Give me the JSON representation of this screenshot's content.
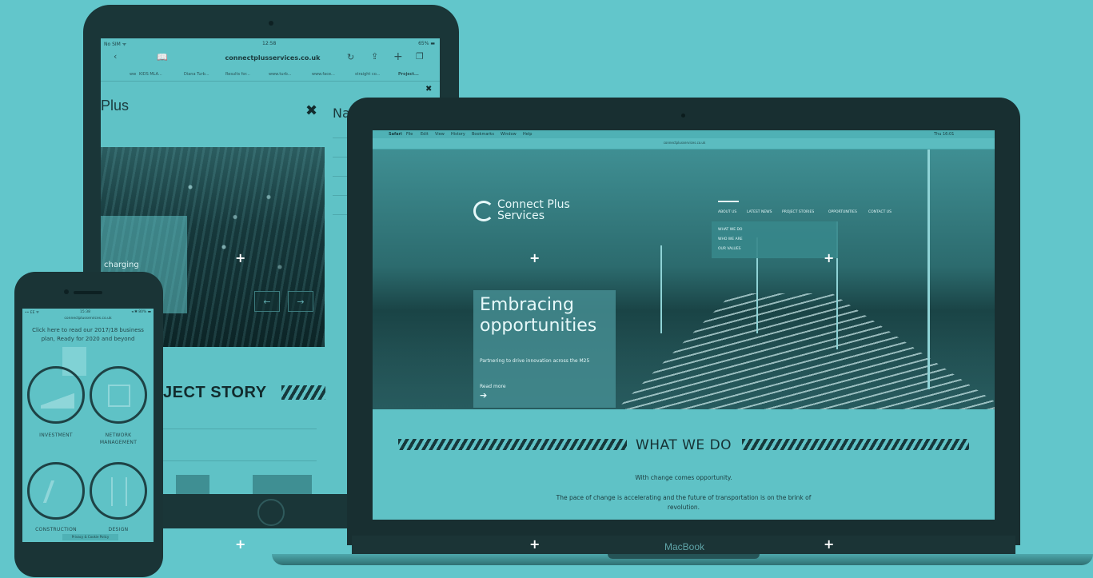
{
  "tablet": {
    "status_left": "No SIM ᯤ",
    "status_time": "12:58",
    "status_right": "65% ▬",
    "url": "connectplusservices.co.uk",
    "favorites": [
      "ww",
      "KIDS MLA...",
      "Diana Turb...",
      "Results for...",
      "www.turb...",
      "www.face...",
      "straight co...",
      "Project..."
    ],
    "page_title": "Plus",
    "nav_title": "Na",
    "image_caption": "charging",
    "section_title": "OJECT STORY"
  },
  "laptop": {
    "menubar": [
      "Safari",
      "File",
      "Edit",
      "View",
      "History",
      "Bookmarks",
      "Window",
      "Help"
    ],
    "menubar_right": "Thu 16:01",
    "url": "connectplusservices.co.uk",
    "logo_line1": "Connect Plus",
    "logo_line2": "Services",
    "nav": [
      "ABOUT US",
      "LATEST NEWS",
      "PROJECT STORIES",
      "OPPORTUNITIES",
      "CONTACT US"
    ],
    "dropdown": [
      "WHAT WE DO",
      "WHO WE ARE",
      "OUR VALUES"
    ],
    "hero_title_1": "Embracing",
    "hero_title_2": "opportunities",
    "hero_subtitle": "Partnering to drive innovation across the M25",
    "hero_link": "Read more",
    "hero_arrow": "➔",
    "section_title": "WHAT WE DO",
    "body_1": "With change comes opportunity.",
    "body_2": "The pace of change is accelerating and the future of transportation is on the brink of revolution.",
    "brand": "MacBook"
  },
  "phone": {
    "status_left": "•• EE ᯤ",
    "status_time": "15:38",
    "status_right": "◂ ✱ 80% ▬",
    "url": "connectplusservices.co.uk",
    "intro": "Click here to read our 2017/18 business plan, Ready for 2020 and beyond",
    "items": [
      "INVESTMENT",
      "NETWORK MANAGEMENT",
      "CONSTRUCTION",
      "DESIGN"
    ],
    "footer": "Privacy & Cookie Policy"
  },
  "icons": {
    "close": "✖",
    "back": "‹",
    "book": "📖",
    "reload": "↻",
    "share": "⇪",
    "add": "+",
    "tabs": "❐",
    "arrow_left": "←",
    "arrow_right": "→",
    "plus": "+"
  },
  "colors": {
    "background": "#62c6cb",
    "device_dark": "#1a3436",
    "accent_light": "#e6f8f9"
  }
}
